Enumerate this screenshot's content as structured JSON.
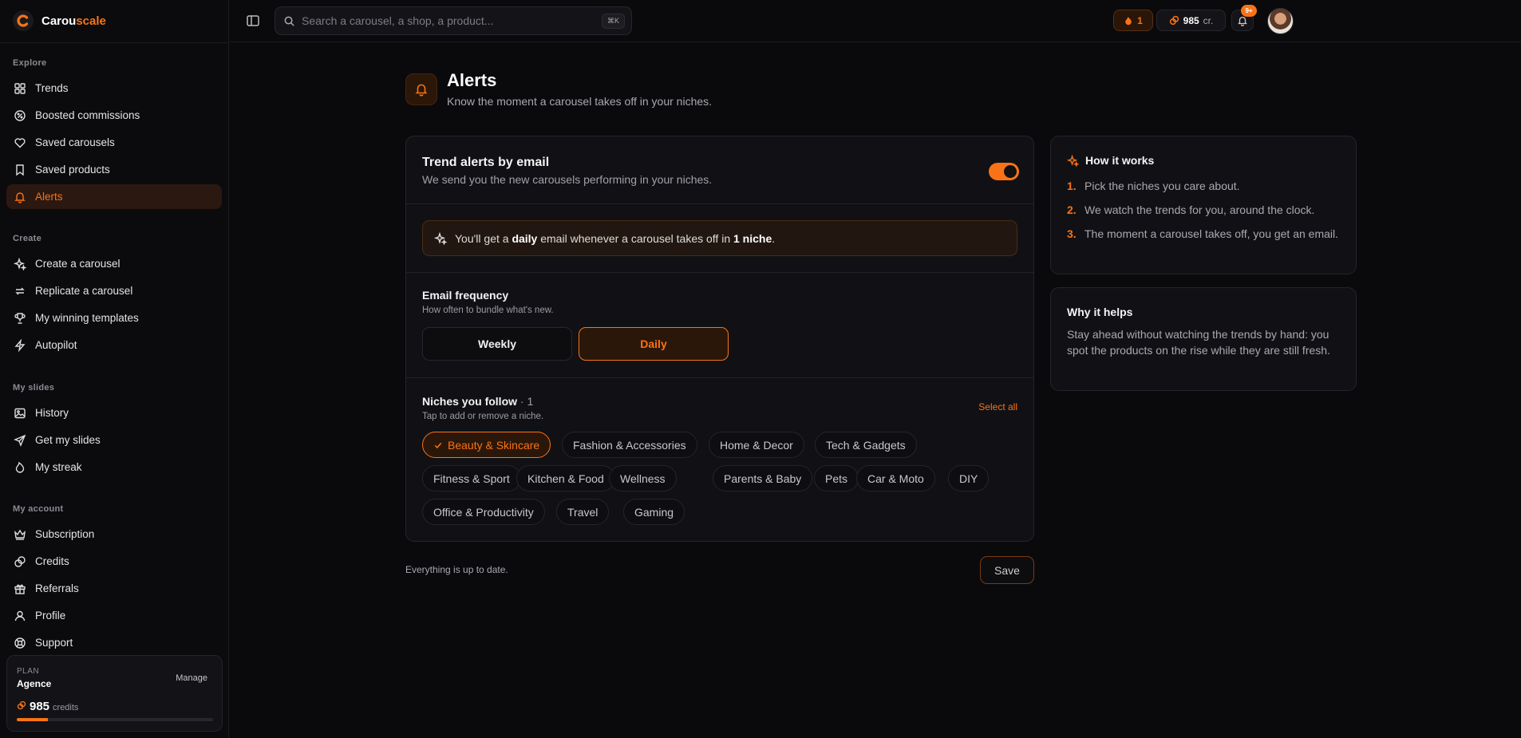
{
  "brand": {
    "name_part1": "Carou",
    "name_part2": "scale"
  },
  "search": {
    "placeholder": "Search a carousel, a shop, a product...",
    "shortcut": "⌘K"
  },
  "topbar": {
    "streak_count": "1",
    "credits_value": "985",
    "credits_unit": "cr.",
    "notifications_badge": "9+"
  },
  "sidebar": {
    "sections": [
      {
        "label": "Explore",
        "items": [
          "Trends",
          "Boosted commissions",
          "Saved carousels",
          "Saved products",
          "Alerts"
        ]
      },
      {
        "label": "Create",
        "items": [
          "Create a carousel",
          "Replicate a carousel",
          "My winning templates",
          "Autopilot"
        ]
      },
      {
        "label": "My slides",
        "items": [
          "History",
          "Get my slides",
          "My streak"
        ]
      },
      {
        "label": "My account",
        "items": [
          "Subscription",
          "Credits",
          "Referrals",
          "Profile",
          "Support"
        ]
      }
    ],
    "active_item": "Alerts",
    "plan": {
      "label": "PLAN",
      "name": "Agence",
      "manage": "Manage",
      "credits": "985",
      "credits_unit": "credits",
      "progress_fraction": 0.16
    }
  },
  "page": {
    "title": "Alerts",
    "subtitle": "Know the moment a carousel takes off in your niches."
  },
  "email_alerts": {
    "title": "Trend alerts by email",
    "subtitle": "We send you the new carousels performing in your niches.",
    "enabled": true,
    "notice_prefix": "You'll get a ",
    "notice_freq": "daily",
    "notice_middle": " email whenever a carousel takes off in ",
    "notice_count": "1 niche",
    "notice_suffix": "."
  },
  "frequency": {
    "title": "Email frequency",
    "subtitle": "How often to bundle what's new.",
    "options": [
      "Weekly",
      "Daily"
    ],
    "selected": "Daily"
  },
  "niches": {
    "title": "Niches you follow",
    "count": " · 1",
    "subtitle": "Tap to add or remove a niche.",
    "select_all": "Select all",
    "items": [
      "Beauty & Skincare",
      "Fashion & Accessories",
      "Home & Decor",
      "Tech & Gadgets",
      "Fitness & Sport",
      "Kitchen & Food",
      "Wellness",
      "Parents & Baby",
      "Pets",
      "Car & Moto",
      "DIY",
      "Office & Productivity",
      "Travel",
      "Gaming"
    ],
    "selected": [
      "Beauty & Skincare"
    ]
  },
  "footer": {
    "status": "Everything is up to date.",
    "save": "Save"
  },
  "how_it_works": {
    "title": "How it works",
    "steps": [
      {
        "num": "1.",
        "text": "Pick the niches you care about."
      },
      {
        "num": "2.",
        "text": "We watch the trends for you, around the clock."
      },
      {
        "num": "3.",
        "text": "The moment a carousel takes off, you get an email."
      }
    ]
  },
  "why_it_helps": {
    "title": "Why it helps",
    "body": "Stay ahead without watching the trends by hand: you spot the products on the rise while they are still fresh."
  },
  "colors": {
    "accent": "#f97316",
    "background": "#0a0a0d",
    "card": "#111115"
  }
}
